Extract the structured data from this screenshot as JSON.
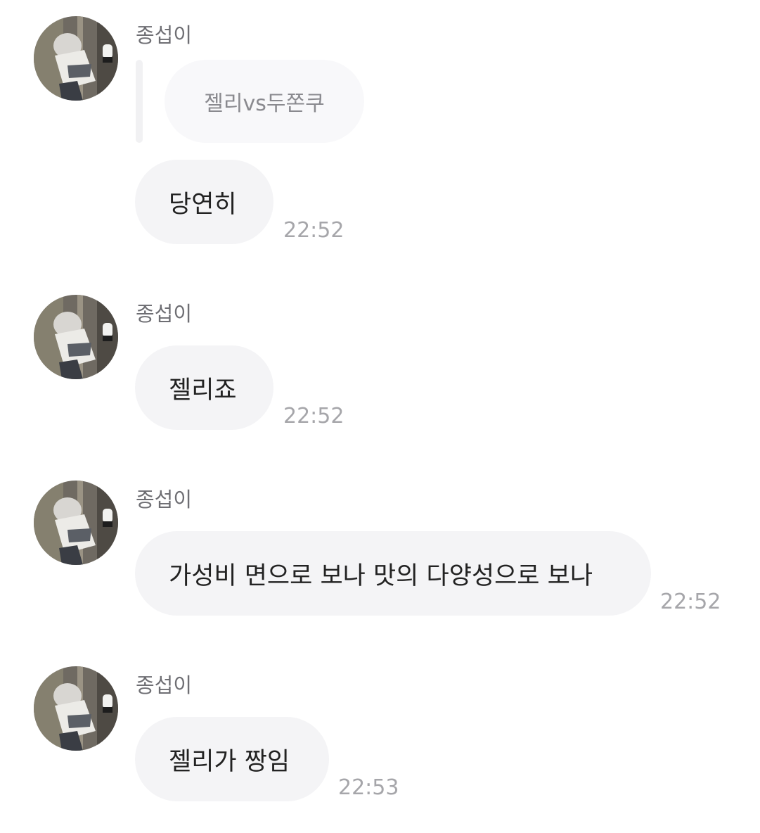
{
  "messages": [
    {
      "sender": "종섭이",
      "avatar_icon": "profile-photo-avatar",
      "quoted_text": "젤리vs두쫀쿠",
      "text": "당연히",
      "time": "22:52"
    },
    {
      "sender": "종섭이",
      "avatar_icon": "profile-photo-avatar",
      "text": "젤리죠",
      "time": "22:52"
    },
    {
      "sender": "종섭이",
      "avatar_icon": "profile-photo-avatar",
      "text": "가성비 면으로 보나 맛의 다양성으로 보나",
      "time": "22:52"
    },
    {
      "sender": "종섭이",
      "avatar_icon": "profile-photo-avatar",
      "text": "젤리가 짱임",
      "time": "22:53"
    }
  ],
  "colors": {
    "bubble_bg": "#f4f4f6",
    "quote_bg": "#f8f8fa",
    "message_text": "#222222",
    "sender_text": "#6e6e73",
    "time_text": "#a6a6aa"
  }
}
